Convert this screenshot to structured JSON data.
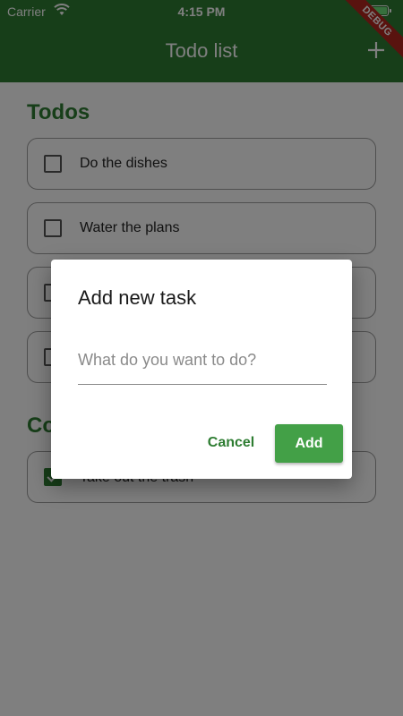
{
  "status_bar": {
    "carrier": "Carrier",
    "time": "4:15 PM"
  },
  "app_bar": {
    "title": "Todo list",
    "add_icon": "plus-icon",
    "debug_banner": "DEBUG"
  },
  "todos_section": {
    "title": "Todos",
    "items": [
      {
        "label": "Do the dishes",
        "checked": false
      },
      {
        "label": "Water the plans",
        "checked": false
      },
      {
        "label": "",
        "checked": false
      },
      {
        "label": "",
        "checked": false
      }
    ]
  },
  "completed_section": {
    "title": "Co",
    "items": [
      {
        "label": "Take out the trash",
        "checked": true
      }
    ]
  },
  "dialog": {
    "title": "Add new task",
    "input_placeholder": "What do you want to do?",
    "input_value": "",
    "cancel_label": "Cancel",
    "add_label": "Add"
  },
  "colors": {
    "primary": "#2e7d32",
    "button": "#43a047",
    "scrim": "rgba(0,0,0,0.5)"
  }
}
